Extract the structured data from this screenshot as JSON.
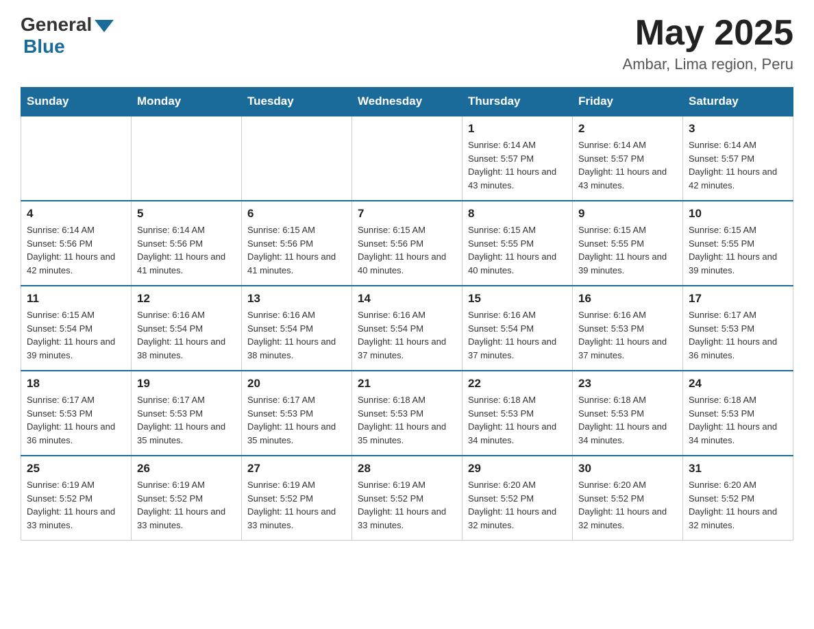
{
  "header": {
    "logo_general": "General",
    "logo_blue": "Blue",
    "month_year": "May 2025",
    "location": "Ambar, Lima region, Peru"
  },
  "days_of_week": [
    "Sunday",
    "Monday",
    "Tuesday",
    "Wednesday",
    "Thursday",
    "Friday",
    "Saturday"
  ],
  "weeks": [
    [
      {
        "day": "",
        "info": ""
      },
      {
        "day": "",
        "info": ""
      },
      {
        "day": "",
        "info": ""
      },
      {
        "day": "",
        "info": ""
      },
      {
        "day": "1",
        "info": "Sunrise: 6:14 AM\nSunset: 5:57 PM\nDaylight: 11 hours and 43 minutes."
      },
      {
        "day": "2",
        "info": "Sunrise: 6:14 AM\nSunset: 5:57 PM\nDaylight: 11 hours and 43 minutes."
      },
      {
        "day": "3",
        "info": "Sunrise: 6:14 AM\nSunset: 5:57 PM\nDaylight: 11 hours and 42 minutes."
      }
    ],
    [
      {
        "day": "4",
        "info": "Sunrise: 6:14 AM\nSunset: 5:56 PM\nDaylight: 11 hours and 42 minutes."
      },
      {
        "day": "5",
        "info": "Sunrise: 6:14 AM\nSunset: 5:56 PM\nDaylight: 11 hours and 41 minutes."
      },
      {
        "day": "6",
        "info": "Sunrise: 6:15 AM\nSunset: 5:56 PM\nDaylight: 11 hours and 41 minutes."
      },
      {
        "day": "7",
        "info": "Sunrise: 6:15 AM\nSunset: 5:56 PM\nDaylight: 11 hours and 40 minutes."
      },
      {
        "day": "8",
        "info": "Sunrise: 6:15 AM\nSunset: 5:55 PM\nDaylight: 11 hours and 40 minutes."
      },
      {
        "day": "9",
        "info": "Sunrise: 6:15 AM\nSunset: 5:55 PM\nDaylight: 11 hours and 39 minutes."
      },
      {
        "day": "10",
        "info": "Sunrise: 6:15 AM\nSunset: 5:55 PM\nDaylight: 11 hours and 39 minutes."
      }
    ],
    [
      {
        "day": "11",
        "info": "Sunrise: 6:15 AM\nSunset: 5:54 PM\nDaylight: 11 hours and 39 minutes."
      },
      {
        "day": "12",
        "info": "Sunrise: 6:16 AM\nSunset: 5:54 PM\nDaylight: 11 hours and 38 minutes."
      },
      {
        "day": "13",
        "info": "Sunrise: 6:16 AM\nSunset: 5:54 PM\nDaylight: 11 hours and 38 minutes."
      },
      {
        "day": "14",
        "info": "Sunrise: 6:16 AM\nSunset: 5:54 PM\nDaylight: 11 hours and 37 minutes."
      },
      {
        "day": "15",
        "info": "Sunrise: 6:16 AM\nSunset: 5:54 PM\nDaylight: 11 hours and 37 minutes."
      },
      {
        "day": "16",
        "info": "Sunrise: 6:16 AM\nSunset: 5:53 PM\nDaylight: 11 hours and 37 minutes."
      },
      {
        "day": "17",
        "info": "Sunrise: 6:17 AM\nSunset: 5:53 PM\nDaylight: 11 hours and 36 minutes."
      }
    ],
    [
      {
        "day": "18",
        "info": "Sunrise: 6:17 AM\nSunset: 5:53 PM\nDaylight: 11 hours and 36 minutes."
      },
      {
        "day": "19",
        "info": "Sunrise: 6:17 AM\nSunset: 5:53 PM\nDaylight: 11 hours and 35 minutes."
      },
      {
        "day": "20",
        "info": "Sunrise: 6:17 AM\nSunset: 5:53 PM\nDaylight: 11 hours and 35 minutes."
      },
      {
        "day": "21",
        "info": "Sunrise: 6:18 AM\nSunset: 5:53 PM\nDaylight: 11 hours and 35 minutes."
      },
      {
        "day": "22",
        "info": "Sunrise: 6:18 AM\nSunset: 5:53 PM\nDaylight: 11 hours and 34 minutes."
      },
      {
        "day": "23",
        "info": "Sunrise: 6:18 AM\nSunset: 5:53 PM\nDaylight: 11 hours and 34 minutes."
      },
      {
        "day": "24",
        "info": "Sunrise: 6:18 AM\nSunset: 5:53 PM\nDaylight: 11 hours and 34 minutes."
      }
    ],
    [
      {
        "day": "25",
        "info": "Sunrise: 6:19 AM\nSunset: 5:52 PM\nDaylight: 11 hours and 33 minutes."
      },
      {
        "day": "26",
        "info": "Sunrise: 6:19 AM\nSunset: 5:52 PM\nDaylight: 11 hours and 33 minutes."
      },
      {
        "day": "27",
        "info": "Sunrise: 6:19 AM\nSunset: 5:52 PM\nDaylight: 11 hours and 33 minutes."
      },
      {
        "day": "28",
        "info": "Sunrise: 6:19 AM\nSunset: 5:52 PM\nDaylight: 11 hours and 33 minutes."
      },
      {
        "day": "29",
        "info": "Sunrise: 6:20 AM\nSunset: 5:52 PM\nDaylight: 11 hours and 32 minutes."
      },
      {
        "day": "30",
        "info": "Sunrise: 6:20 AM\nSunset: 5:52 PM\nDaylight: 11 hours and 32 minutes."
      },
      {
        "day": "31",
        "info": "Sunrise: 6:20 AM\nSunset: 5:52 PM\nDaylight: 11 hours and 32 minutes."
      }
    ]
  ]
}
